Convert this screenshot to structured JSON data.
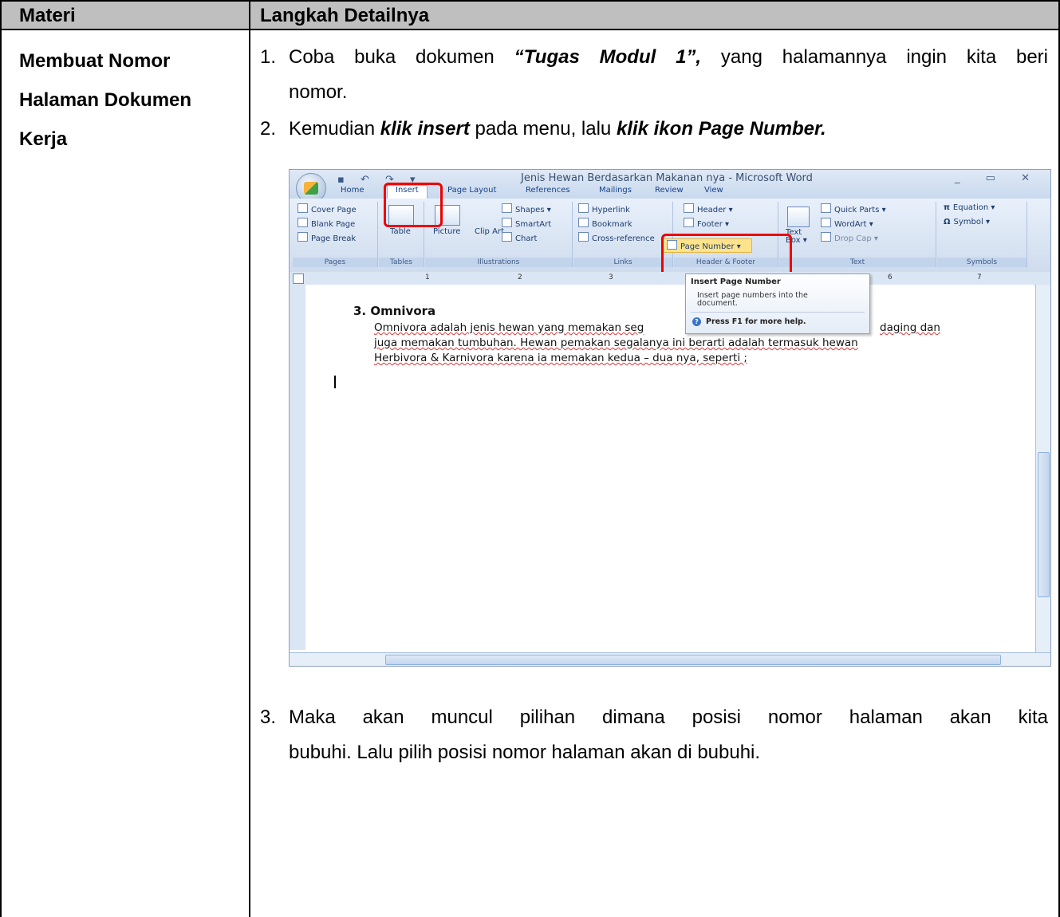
{
  "table": {
    "header_left": "Materi",
    "header_right": "Langkah Detailnya",
    "topic_lines": [
      "Membuat Nomor",
      "Halaman Dokumen",
      "Kerja"
    ]
  },
  "steps": [
    {
      "num": "1.",
      "pre": "Coba buka dokumen ",
      "emph": "“Tugas Modul 1”,",
      "post": "  yang halamannya ingin kita beri",
      "line2": "nomor."
    },
    {
      "num": "2.",
      "pre": "Kemudian ",
      "emph": "klik insert",
      "mid": " pada menu, lalu ",
      "emph2": "klik ikon Page Number."
    },
    {
      "num": "3.",
      "line1": "Maka akan muncul pilihan dimana posisi nomor halaman akan kita",
      "line2": "bubuhi. Lalu pilih posisi nomor halaman akan di bubuhi."
    }
  ],
  "word": {
    "window_title": "Jenis Hewan Berdasarkan Makanan nya - Microsoft Word",
    "window_controls": "_ ▭ ✕",
    "quick_access": "▪ ↶ ↷ ▾",
    "tabs": [
      "Home",
      "Insert",
      "Page Layout",
      "References",
      "Mailings",
      "Review",
      "View"
    ],
    "groups": {
      "pages": {
        "label": "Pages",
        "items": [
          "Cover Page",
          "Blank Page",
          "Page Break"
        ]
      },
      "tables": {
        "label": "Tables",
        "items": [
          "Table"
        ]
      },
      "illustrations": {
        "label": "Illustrations",
        "items": [
          "Picture",
          "Clip Art",
          "Shapes ▾",
          "SmartArt",
          "Chart"
        ]
      },
      "links": {
        "label": "Links",
        "items": [
          "Hyperlink",
          "Bookmark",
          "Cross-reference"
        ]
      },
      "header_footer": {
        "label": "Header & Footer",
        "items": [
          "Header ▾",
          "Footer ▾",
          "Page Number ▾"
        ]
      },
      "text": {
        "label": "Text",
        "items": [
          "Text Box ▾",
          "Quick Parts ▾",
          "WordArt ▾",
          "Drop Cap ▾"
        ]
      },
      "symbols": {
        "label": "Symbols",
        "items": [
          "Equation ▾",
          "Symbol ▾"
        ]
      }
    },
    "ruler_numbers": [
      "1",
      "2",
      "3",
      "6",
      "7"
    ],
    "tooltip": {
      "title": "Insert Page Number",
      "description": "Insert page numbers into the document.",
      "help": "Press F1 for more help."
    },
    "doc": {
      "heading": "3.  Omnivora",
      "lines": [
        "Omnivora adalah jenis hewan yang memakan seg",
        "daging dan",
        "juga memakan tumbuhan. Hewan pemakan segalanya ini berarti adalah termasuk hewan",
        "Herbivora & Karnivora karena ia memakan kedua – dua nya, seperti ;"
      ]
    }
  }
}
